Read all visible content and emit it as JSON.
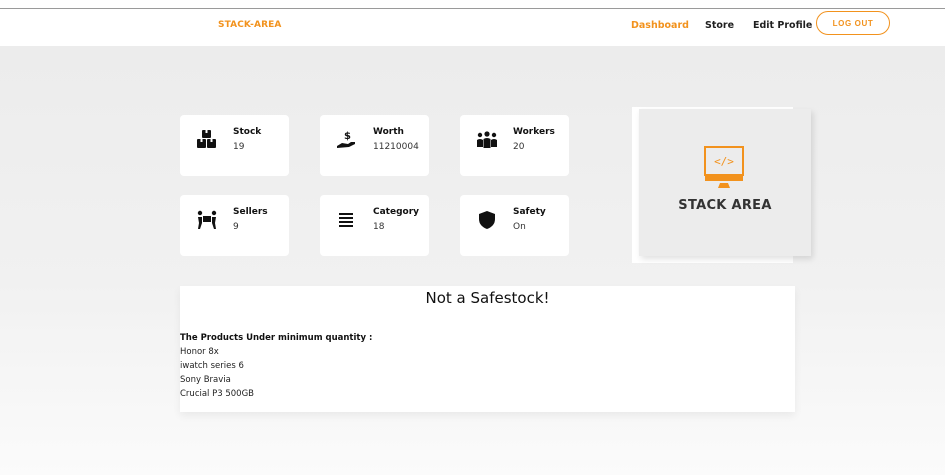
{
  "navbar": {
    "brand": "STACK-AREA",
    "links": [
      "Dashboard",
      "Store",
      "Edit Profile"
    ],
    "active_link": "Dashboard",
    "logout_label": "LOG OUT"
  },
  "colors": {
    "accent": "#f2921d",
    "background": "#ececec",
    "card": "#ffffff"
  },
  "stats": [
    {
      "title": "Stock",
      "value": "19",
      "icon": "boxes-icon"
    },
    {
      "title": "Worth",
      "value": "11210004",
      "icon": "hand-money-icon"
    },
    {
      "title": "Workers",
      "value": "20",
      "icon": "users-icon"
    },
    {
      "title": "Sellers",
      "value": "9",
      "icon": "people-carry-icon"
    },
    {
      "title": "Category",
      "value": "18",
      "icon": "list-icon"
    },
    {
      "title": "Safety",
      "value": "On",
      "icon": "shield-icon"
    }
  ],
  "logo": {
    "text": "STACK AREA",
    "icon": "code-monitor-icon"
  },
  "panel": {
    "title": "Not a Safestock!",
    "label": "The Products Under minimum quantity :",
    "products": [
      "Honor 8x",
      "iwatch series 6",
      "Sony Bravia",
      "Crucial P3 500GB"
    ]
  }
}
